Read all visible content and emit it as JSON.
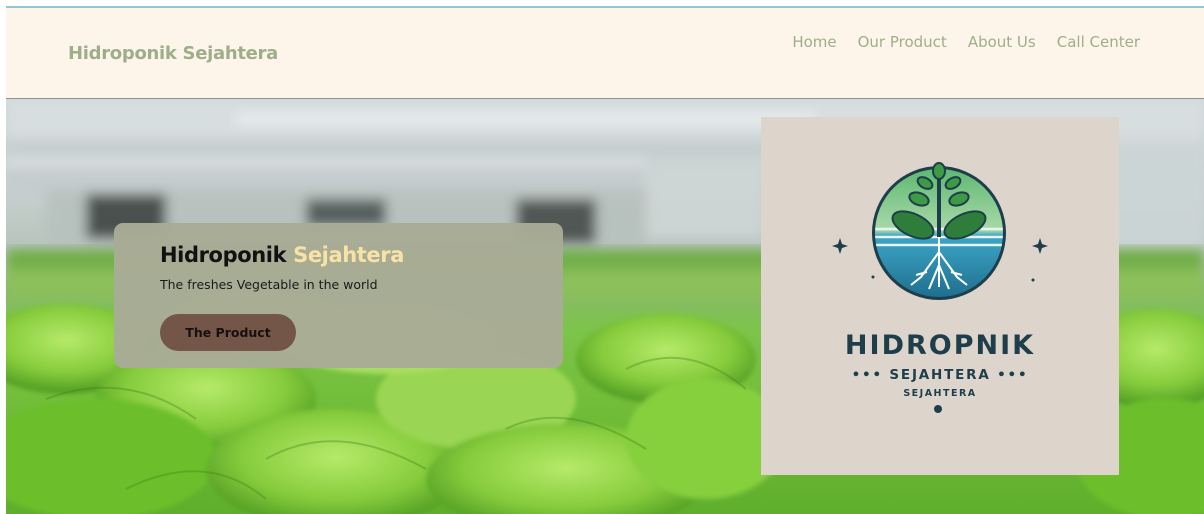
{
  "header": {
    "brand": "Hidroponik Sejahtera",
    "nav": [
      {
        "label": "Home"
      },
      {
        "label": "Our Product"
      },
      {
        "label": "About Us"
      },
      {
        "label": "Call Center"
      }
    ]
  },
  "hero": {
    "title_main": "Hidroponik",
    "title_accent": "Sejahtera",
    "subtitle": "The freshes Vegetable in the world",
    "button_label": "The Product"
  },
  "logo": {
    "line1": "HIDROPNIK",
    "line2": "••• SEJAHTERA •••",
    "line3": "SEJAHTERA"
  },
  "colors": {
    "nav_bg": "#fdf5ea",
    "brand_text": "#9fae8a",
    "card_bg": "#a8ab96",
    "accent_text": "#f7e3a8",
    "button_bg": "#745648",
    "logo_text": "#1d3e4a"
  }
}
